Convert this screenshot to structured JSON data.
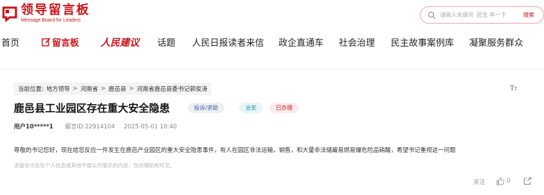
{
  "header": {
    "logo_title": "领导留言板",
    "logo_subtitle": "Message Board for Leaders",
    "search_placeholder": "请输入关键词  民生 年一下",
    "search_button": "搜索"
  },
  "nav": {
    "items": [
      {
        "label": "首页"
      },
      {
        "label": "留言板"
      },
      {
        "label": "人民建议"
      },
      {
        "label": "话题"
      },
      {
        "label": "人民日报读者来信"
      },
      {
        "label": "政企直通车"
      },
      {
        "label": "社会治理"
      },
      {
        "label": "民主故事案例库"
      },
      {
        "label": "凝聚服务群众"
      }
    ]
  },
  "breadcrumb": {
    "prefix": "当前位置:",
    "items": [
      "地方领导",
      "河南省",
      "鹿邑县",
      "河南省鹿邑县委书记郭俊涛"
    ],
    "separator": ">"
  },
  "font_size_label": "T",
  "font_size_label_small": "T",
  "post": {
    "title": "鹿邑县工业园区存在重大安全隐患",
    "tags": {
      "category": "投诉/求助",
      "type": "治安",
      "status": "已办理"
    },
    "user": "用户10*****1",
    "id_label": "留言ID:22914104",
    "datetime": "2025-05-01 10:40",
    "content": "尊敬的书记您好，现在给您反应一件发生在鹿邑产业园区的重大安全隐患事件，有人在园区非法运输，销售，和大量非法储藏易燃易爆危险品硝酸，希望书记重视这一问题",
    "notice": "该留言中含有个人信息或其他不便公开展示的内容，仅办理机构可见。"
  },
  "actions": {
    "follow": "关注",
    "like_count": "0"
  },
  "colors": {
    "brand_red": "#c8161d",
    "tag_cat_text": "#3a5ca8",
    "tag_type_text": "#2a8fa6"
  }
}
